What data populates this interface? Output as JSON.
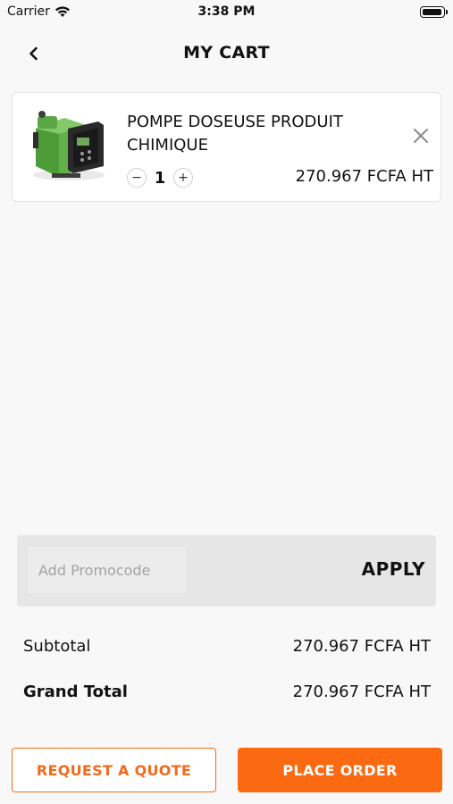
{
  "status_bar": {
    "carrier": "Carrier",
    "time": "3:38 PM"
  },
  "nav": {
    "title": "MY CART"
  },
  "cart_items": [
    {
      "name": "POMPE DOSEUSE PRODUIT CHIMIQUE",
      "quantity": "1",
      "price": "270.967 FCFA HT",
      "qty_minus": "−",
      "qty_plus": "+"
    }
  ],
  "promo": {
    "placeholder": "Add Promocode",
    "value": "",
    "apply_label": "APPLY"
  },
  "totals": {
    "subtotal_label": "Subtotal",
    "subtotal_value": "270.967 FCFA HT",
    "grand_total_label": "Grand Total",
    "grand_total_value": "270.967 FCFA HT"
  },
  "actions": {
    "request_quote_label": "REQUEST A QUOTE",
    "place_order_label": "PLACE ORDER"
  },
  "icons": {
    "wifi": "wifi-icon",
    "battery": "battery-icon",
    "back": "chevron-left-icon",
    "remove": "close-icon",
    "product": "dosing-pump-image"
  },
  "colors": {
    "accent": "#fb6a10",
    "background": "#f8f8f8",
    "promo_background": "#e6e6e6"
  }
}
